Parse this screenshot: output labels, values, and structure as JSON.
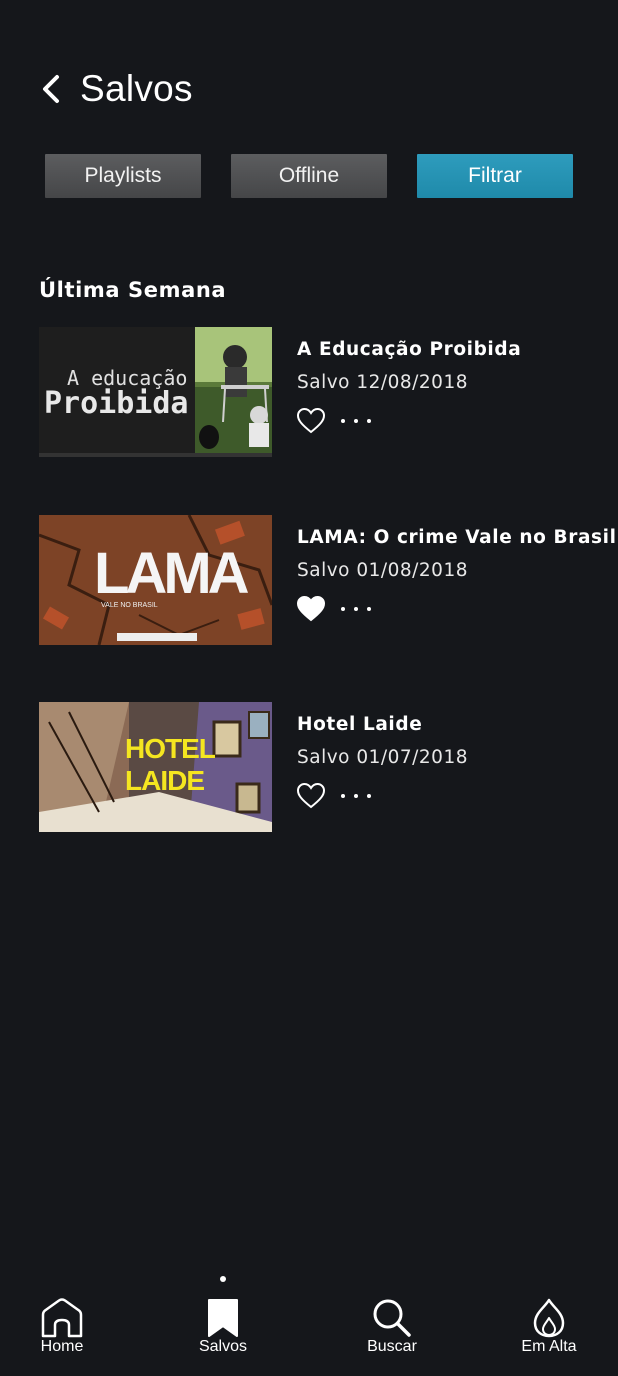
{
  "header": {
    "title": "Salvos",
    "back_icon": "chevron-left-icon"
  },
  "filters": [
    {
      "label": "Playlists",
      "active": false
    },
    {
      "label": "Offline",
      "active": false
    },
    {
      "label": "Filtrar",
      "active": true
    }
  ],
  "section": {
    "title": "Última Semana"
  },
  "items": [
    {
      "title": "A Educação Proibida",
      "saved": "Salvo 12/08/2018",
      "liked": false,
      "thumb_text": {
        "line1": "A educação",
        "line2": "Proibida"
      }
    },
    {
      "title": "LAMA: O crime Vale no Brasil",
      "saved": "Salvo 01/08/2018",
      "liked": true,
      "thumb_text": {
        "line1": "LAMA",
        "line2": "VALE NO BRASIL"
      }
    },
    {
      "title": "Hotel Laide",
      "saved": "Salvo 01/07/2018",
      "liked": false,
      "thumb_text": {
        "line1": "HOTEL",
        "line2": "LAIDE"
      }
    }
  ],
  "nav": [
    {
      "label": "Home",
      "icon": "home-icon",
      "active": false
    },
    {
      "label": "Salvos",
      "icon": "bookmark-icon",
      "active": true
    },
    {
      "label": "Buscar",
      "icon": "search-icon",
      "active": false
    },
    {
      "label": "Em Alta",
      "icon": "flame-icon",
      "active": false
    }
  ],
  "colors": {
    "background": "#15171b",
    "accent": "#2396b8",
    "chip": "#4f5052"
  }
}
